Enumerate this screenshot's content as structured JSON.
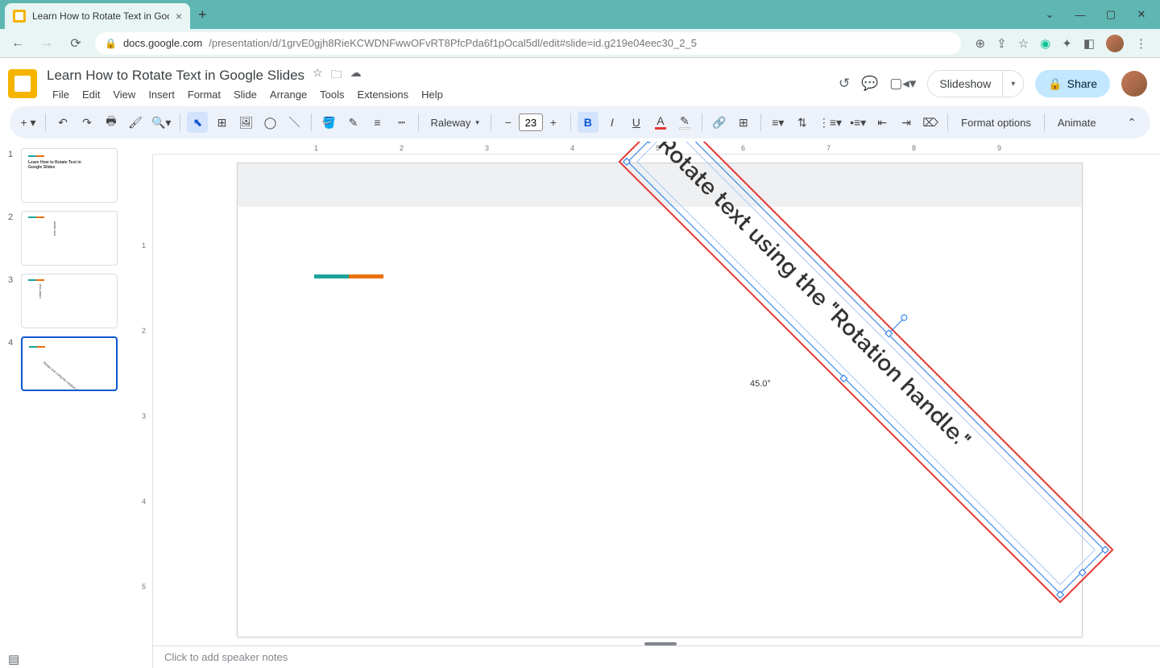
{
  "browser": {
    "tab_title": "Learn How to Rotate Text in Goo",
    "url_host": "docs.google.com",
    "url_path": "/presentation/d/1grvE0gjh8RieKCWDNFwwOFvRT8PfcPda6f1pOcal5dl/edit#slide=id.g219e04eec30_2_5"
  },
  "doc": {
    "title": "Learn How to Rotate Text in Google Slides",
    "menus": [
      "File",
      "Edit",
      "View",
      "Insert",
      "Format",
      "Slide",
      "Arrange",
      "Tools",
      "Extensions",
      "Help"
    ],
    "slideshow": "Slideshow",
    "share": "Share"
  },
  "toolbar": {
    "font": "Raleway",
    "fontsize": "23",
    "format_options": "Format options",
    "animate": "Animate"
  },
  "slides": {
    "count": 4,
    "active": 4,
    "thumb1_line1": "Learn How to Rotate Text in",
    "thumb1_line2": "Google Slides"
  },
  "canvas": {
    "textbox_content": "Rotate text using the \"Rotation handle.\"",
    "angle_label": "45.0°"
  },
  "notes": {
    "placeholder": "Click to add speaker notes"
  },
  "ruler_h": [
    "1",
    "2",
    "3",
    "4",
    "5",
    "6",
    "7",
    "8",
    "9"
  ],
  "ruler_v": [
    "1",
    "2",
    "3",
    "4",
    "5"
  ]
}
